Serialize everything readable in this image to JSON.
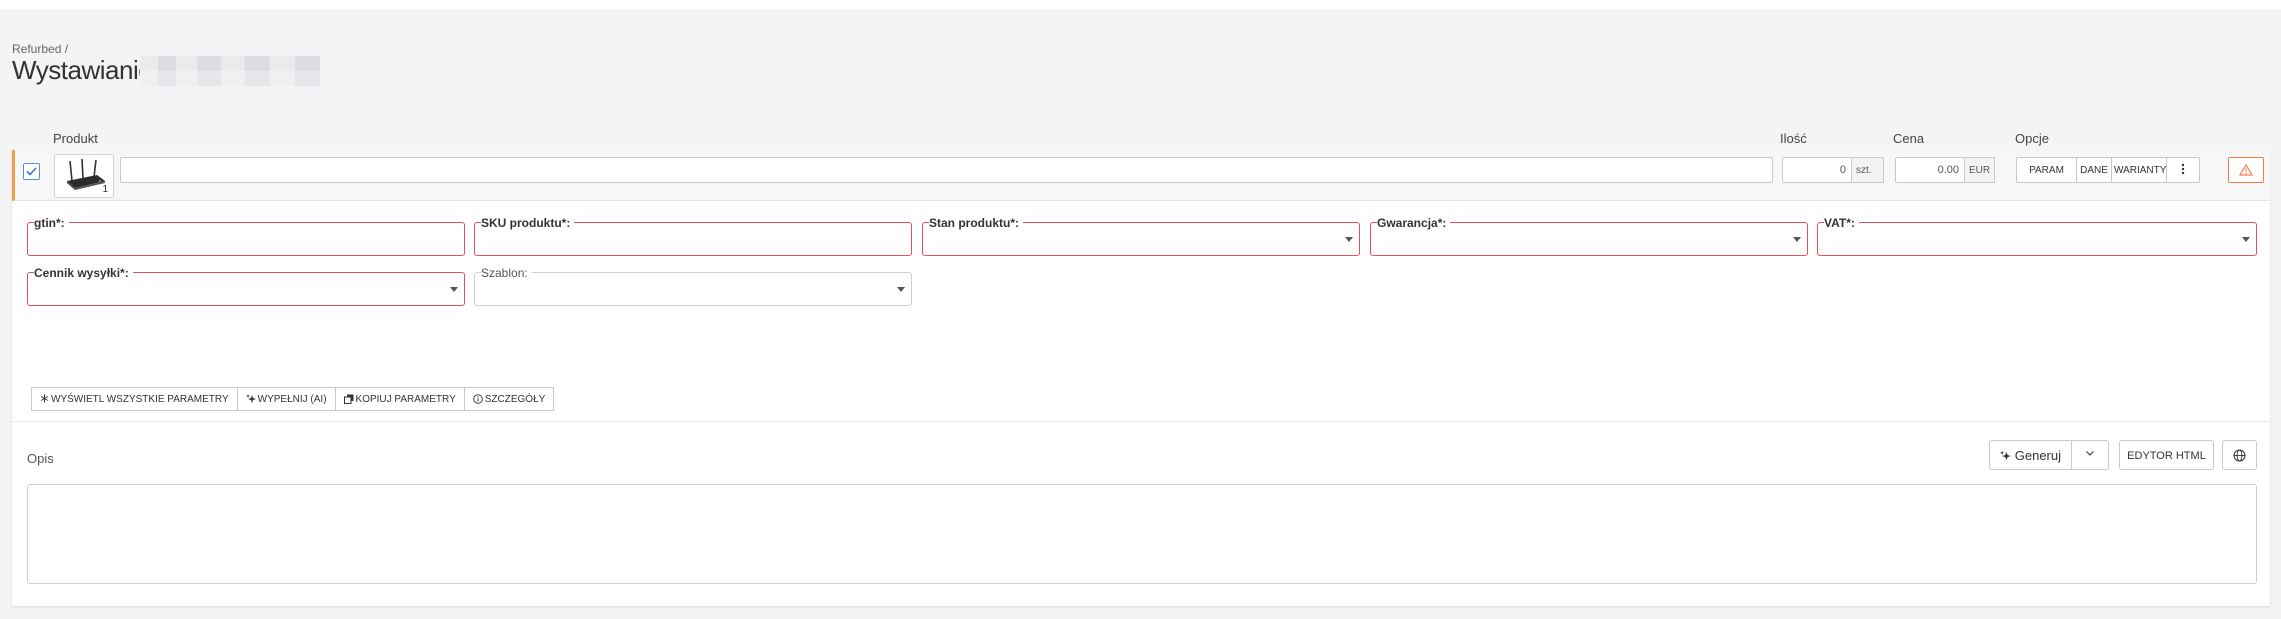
{
  "header": {
    "breadcrumb": "Refurbed /",
    "title": "Wystawianie"
  },
  "columns": {
    "product": "Produkt",
    "quantity": "Ilość",
    "price": "Cena",
    "options": "Opcje"
  },
  "product_row": {
    "checked": true,
    "image_count": "1",
    "name_value": "",
    "quantity_value": "0",
    "quantity_unit": "szt.",
    "price_value": "0.00",
    "currency": "EUR",
    "options": {
      "param": "PARAM",
      "dane": "DANE",
      "warianty": "WARIANTY"
    },
    "warning_color": "#f07b4f",
    "accent_color": "#f0a04b"
  },
  "fields": {
    "gtin": {
      "label": "gtin*:",
      "value": ""
    },
    "sku": {
      "label": "SKU produktu*:",
      "value": ""
    },
    "stan": {
      "label": "Stan produktu*:",
      "value": ""
    },
    "gwarancja": {
      "label": "Gwarancja*:",
      "value": ""
    },
    "vat": {
      "label": "VAT*:",
      "value": ""
    },
    "cennik": {
      "label": "Cennik wysyłki*:",
      "value": ""
    },
    "szablon": {
      "label": "Szablon:",
      "value": ""
    }
  },
  "actions": {
    "show_all": "WYŚWIETL WSZYSTKIE PARAMETRY",
    "fill_ai": "WYPEŁNIJ (AI)",
    "copy_params": "KOPIUJ PARAMETRY",
    "details": "SZCZEGÓŁY"
  },
  "description": {
    "label": "Opis",
    "generate": "Generuj",
    "html_editor": "EDYTOR HTML",
    "value": ""
  },
  "colors": {
    "required_border": "#e8505b",
    "checkbox": "#5b8bd4"
  }
}
